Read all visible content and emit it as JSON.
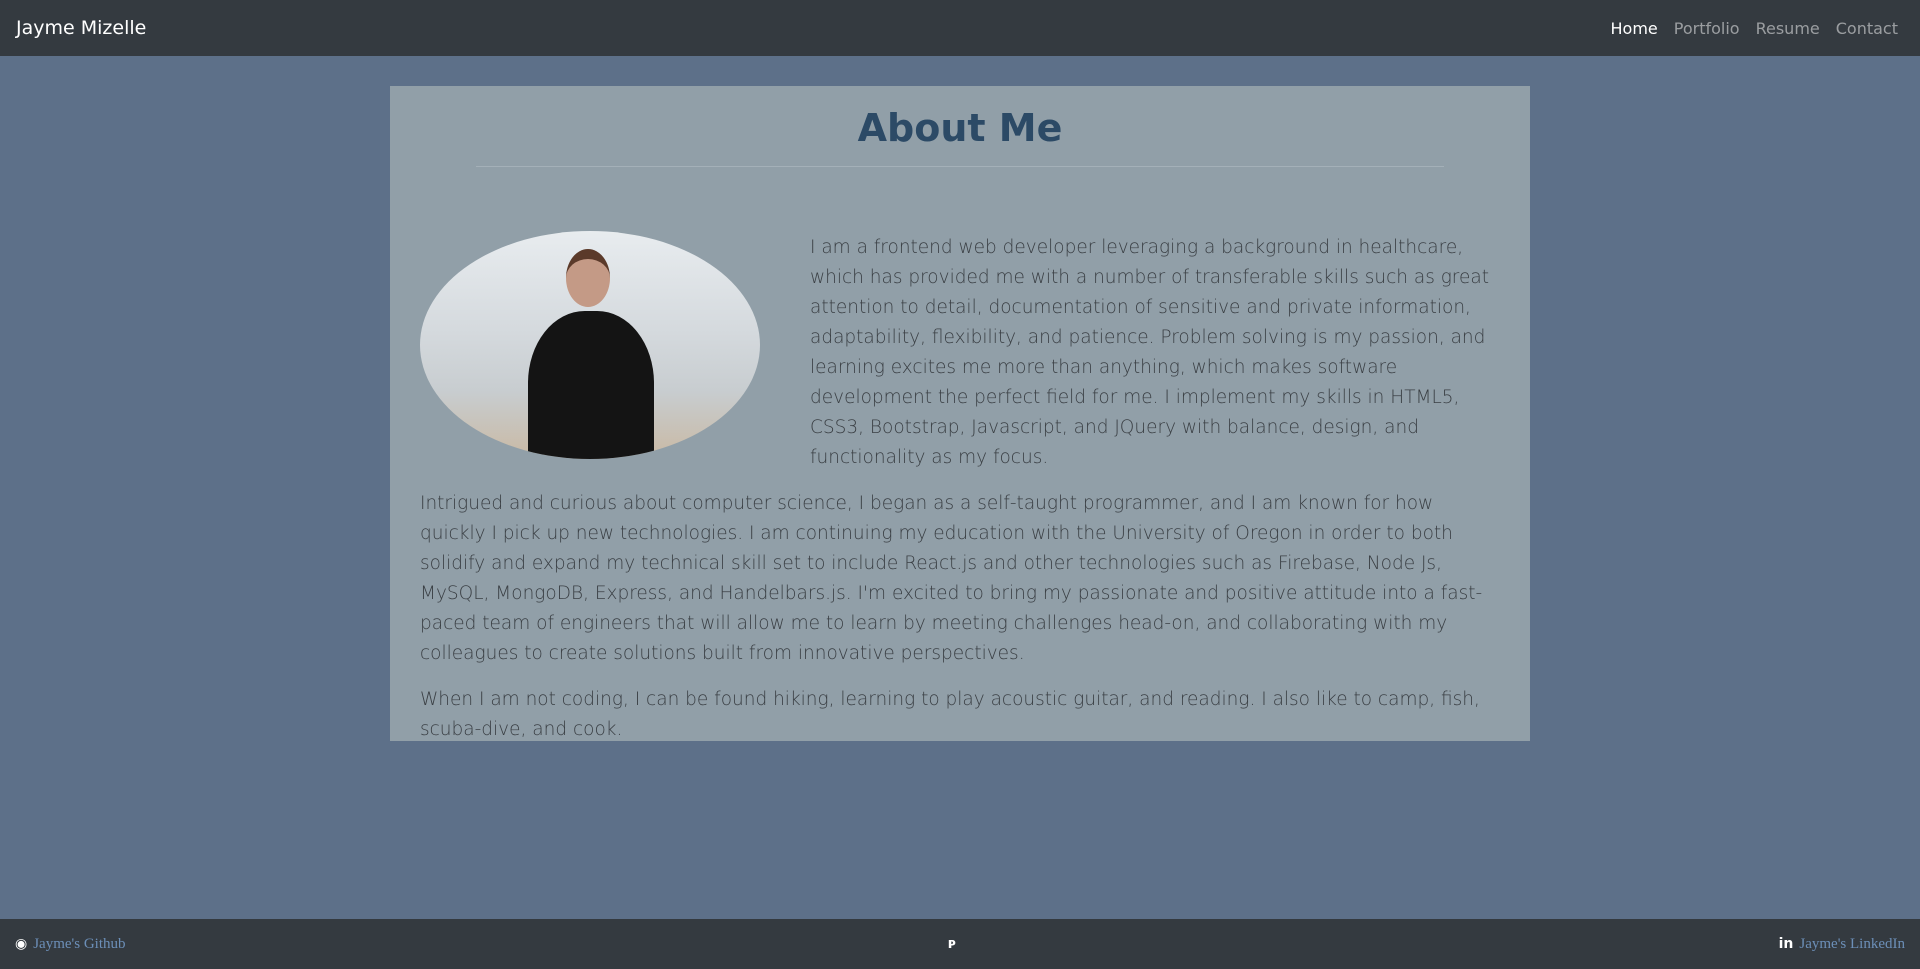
{
  "navbar": {
    "brand": "Jayme Mizelle",
    "links": [
      {
        "label": "Home",
        "active": true
      },
      {
        "label": "Portfolio"
      },
      {
        "label": "Resume"
      },
      {
        "label": "Contact"
      }
    ]
  },
  "about": {
    "title": "About Me",
    "paragraphs": [
      "I am a frontend web developer leveraging a background in healthcare, which has provided me with a number of transferable skills such as great attention to detail, documentation of sensitive and private information, adaptability, flexibility, and patience. Problem solving is my passion, and learning excites me more than anything, which makes software development the perfect field for me. I implement my skills in HTML5, CSS3, Bootstrap, Javascript, and JQuery with balance, design, and functionality as my focus.",
      "Intrigued and curious about computer science, I began as a self-taught programmer, and I am known for how quickly I pick up new technologies. I am continuing my education with the University of Oregon in order to both solidify and expand my technical skill set to include React.js and other technologies such as Firebase, Node Js, MySQL, MongoDB, Express, and Handelbars.js. I'm excited to bring my passionate and positive attitude into a fast-paced team of engineers that will allow me to learn by meeting challenges head-on, and collaborating with my colleagues to create solutions built from innovative perspectives.",
      "When I am not coding, I can be found hiking, learning to play acoustic guitar, and reading. I also like to camp, fish, scuba-dive, and cook."
    ]
  },
  "footer": {
    "github": "Jayme's Github",
    "linkedin": "Jayme's LinkedIn",
    "github_icon": "github-icon",
    "linkedin_icon": "linkedin-icon",
    "logo_icon": "logo-icon"
  }
}
